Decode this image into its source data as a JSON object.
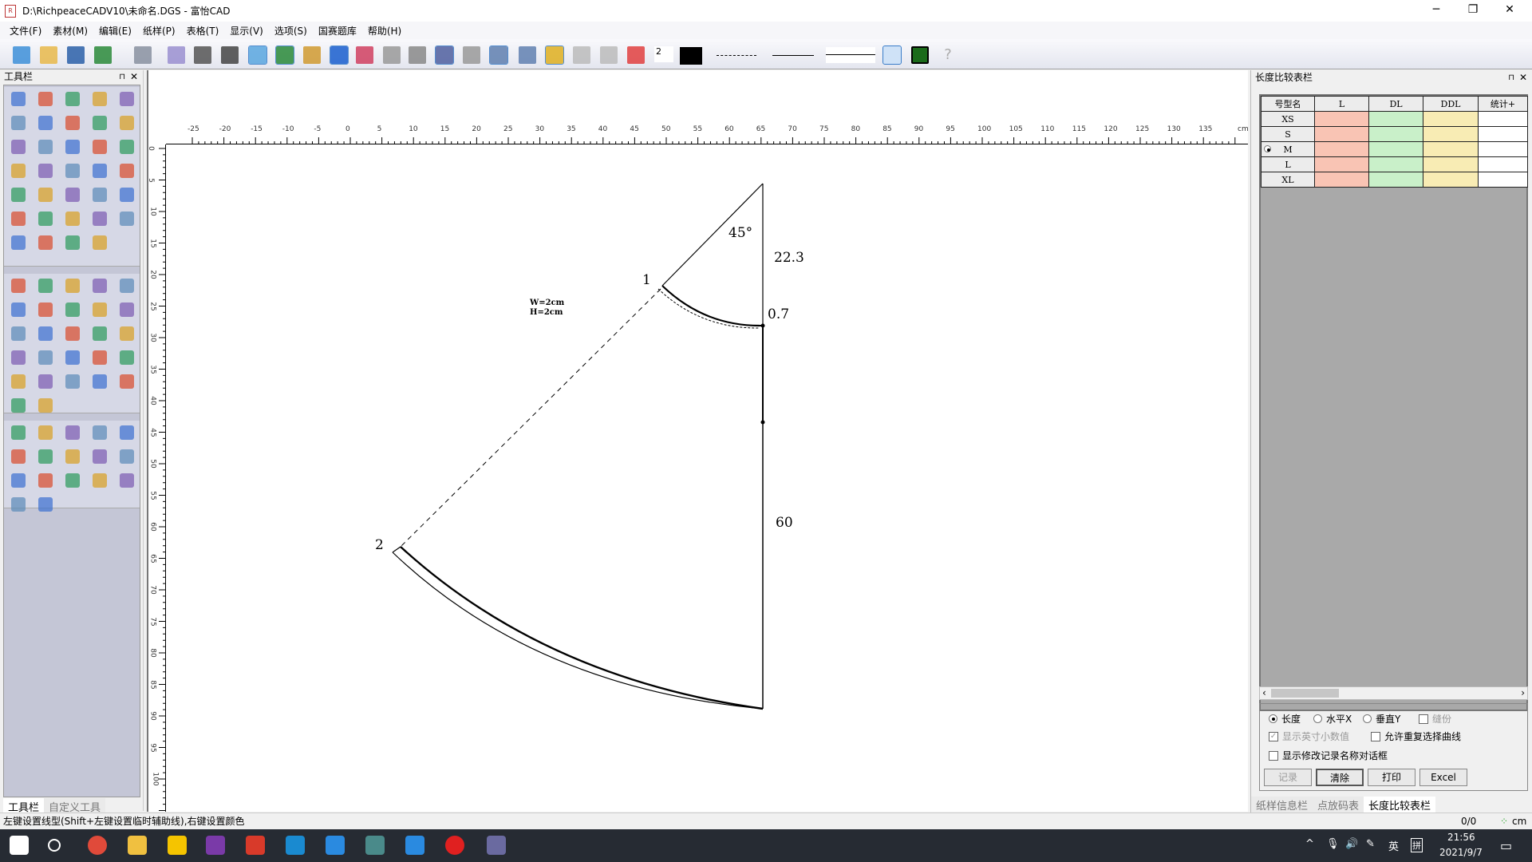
{
  "window": {
    "title": "D:\\RichpeaceCADV10\\未命名.DGS - 富怡CAD",
    "minimize": "─",
    "restore": "❐",
    "close": "✕"
  },
  "menu": [
    "文件(F)",
    "素材(M)",
    "编辑(E)",
    "纸样(P)",
    "表格(T)",
    "显示(V)",
    "选项(S)",
    "国赛题库",
    "帮助(H)"
  ],
  "toolbar": {
    "line_width_value": "2",
    "color": "#000000",
    "icons": [
      "new-file-icon",
      "open-folder-icon",
      "save-icon",
      "undo-icon",
      "redo-icon",
      "eraser-icon",
      "plotter-icon",
      "grid-table-icon",
      "pattern-outline-icon",
      "pattern-fill-icon",
      "lock-user-icon",
      "sigma-icon",
      "align-lines-icon",
      "brush-icon",
      "stack-icon",
      "point-grid-icon",
      "curve-graph-icon",
      "measure-icon",
      "ruler-icon",
      "star-icon",
      "shirt-icon",
      "shirt-back-icon",
      "color-wheel-icon"
    ],
    "right_icons": [
      "seam-triangles-icon",
      "film-icon",
      "help-cursor-icon"
    ]
  },
  "left_panel": {
    "title": "工具栏",
    "tabs": [
      "工具栏",
      "自定义工具"
    ],
    "active_tab": 0,
    "pin": "⊓",
    "close": "✕"
  },
  "tool_groups": [
    [
      "select-arrow-icon",
      "adjust-tool-icon",
      "smart-pen-icon",
      "curve-tool-icon",
      "red-pen-icon",
      "ruler-icon",
      "arc-cut-icon",
      "point-line-icon",
      "scissors-red-icon",
      "line-tool-icon",
      "right-angle-icon",
      "arc-icon",
      "compass-icon",
      "cut-scissors-icon",
      "label-icon",
      "chain-icon",
      "cross-cut-icon",
      "star-point-icon",
      "text-a-icon",
      "highlight-icon",
      "semicircle-icon",
      "blocks-icon",
      "mirror-icon",
      "rotate-icon",
      "house-icon",
      "table-icon",
      "mountain-icon",
      "bottle-icon",
      "shapes-icon",
      "spiral-icon",
      "text-t-icon",
      "list-icon",
      "link-icon",
      "unlink-icon"
    ],
    [
      "piece-icon",
      "pocket-icon",
      "pleat-icon",
      "sleeve-icon",
      "fold-icon",
      "dart-icon",
      "tuck-icon",
      "box-pleat-icon",
      "circle-grid-icon",
      "width-icon",
      "cut-piece-icon",
      "image-icon",
      "rotate-piece-icon",
      "split-icon",
      "seam-icon",
      "body-icon",
      "garment-icon",
      "bust-icon",
      "rotate-dart-icon",
      "fringe-icon",
      "curve-piece-icon",
      "flat-icon",
      "grain-icon",
      "frame-icon",
      "scatter-icon",
      "stack-layers-icon",
      "book-icon"
    ],
    [
      "grade-point-icon",
      "copy-grade-icon",
      "grade-table-icon",
      "grade-move-icon",
      "grade-align-icon",
      "piece-grade-icon",
      "curve-grade-icon",
      "distance-icon",
      "angle-grade-icon",
      "arc-grade-icon",
      "frame-grade-icon",
      "dart-grade-icon",
      "arch-icon",
      "diagonal-icon",
      "angle-icon",
      "horizontal-grade-icon",
      "vertical-grade-icon"
    ]
  ],
  "canvas": {
    "h_ruler_labels": [
      "-25",
      "-20",
      "-15",
      "-10",
      "-5",
      "0",
      "5",
      "10",
      "15",
      "20",
      "25",
      "30",
      "35",
      "40",
      "45",
      "50",
      "55",
      "60",
      "65",
      "70",
      "75",
      "80",
      "85",
      "90",
      "95",
      "100",
      "105",
      "110",
      "115",
      "120",
      "125",
      "130",
      "135"
    ],
    "h_ruler_unit": "cm",
    "v_ruler_labels": [
      "0",
      "5",
      "10",
      "15",
      "20",
      "25",
      "30",
      "35",
      "40",
      "45",
      "50",
      "55",
      "60",
      "65",
      "70",
      "75",
      "80",
      "85",
      "90",
      "95",
      "100"
    ],
    "labels": {
      "angle": "45°",
      "top_length": "22.3",
      "offset": "0.7",
      "side_length": "60",
      "point1": "1",
      "point2": "2",
      "grid_w": "W=2cm",
      "grid_h": "H=2cm"
    }
  },
  "right_panel": {
    "title": "长度比较表栏",
    "pin": "⊓",
    "close": "✕",
    "columns": [
      "号型名",
      "L",
      "DL",
      "DDL",
      "统计+"
    ],
    "sizes": [
      "XS",
      "S",
      "M",
      "L",
      "XL"
    ],
    "selected_size": "M",
    "radios": [
      {
        "label": "长度",
        "checked": true
      },
      {
        "label": "水平X",
        "checked": false
      },
      {
        "label": "垂直Y",
        "checked": false
      }
    ],
    "checkboxes": [
      {
        "label": "缝份",
        "checked": false,
        "disabled": true
      },
      {
        "label": "显示英寸小数值",
        "checked": true,
        "disabled": true
      },
      {
        "label": "允许重复选择曲线",
        "checked": false
      },
      {
        "label": "显示修改记录名称对话框",
        "checked": false
      }
    ],
    "buttons": [
      "记录",
      "清除",
      "打印",
      "Excel"
    ],
    "tabs": [
      "纸样信息栏",
      "点放码表",
      "长度比较表栏"
    ],
    "active_tab": 2
  },
  "status": {
    "text": "左键设置线型(Shift+左键设置临时辅助线),右键设置颜色",
    "count": "0/0",
    "unit": "cm"
  },
  "taskbar": {
    "apps": [
      "start-icon",
      "search-icon",
      "chrome-icon",
      "file-explorer-icon",
      "sticky-notes-icon",
      "onenote-icon",
      "app-red-icon",
      "edge-icon",
      "feishu-icon",
      "app-hex-icon",
      "mail-icon",
      "record-icon",
      "richpeace-cad-icon"
    ],
    "tray": {
      "chevron": "^",
      "ime_lang": "英",
      "ime_mode": "拼",
      "time": "21:56",
      "date": "2021/9/7"
    }
  }
}
